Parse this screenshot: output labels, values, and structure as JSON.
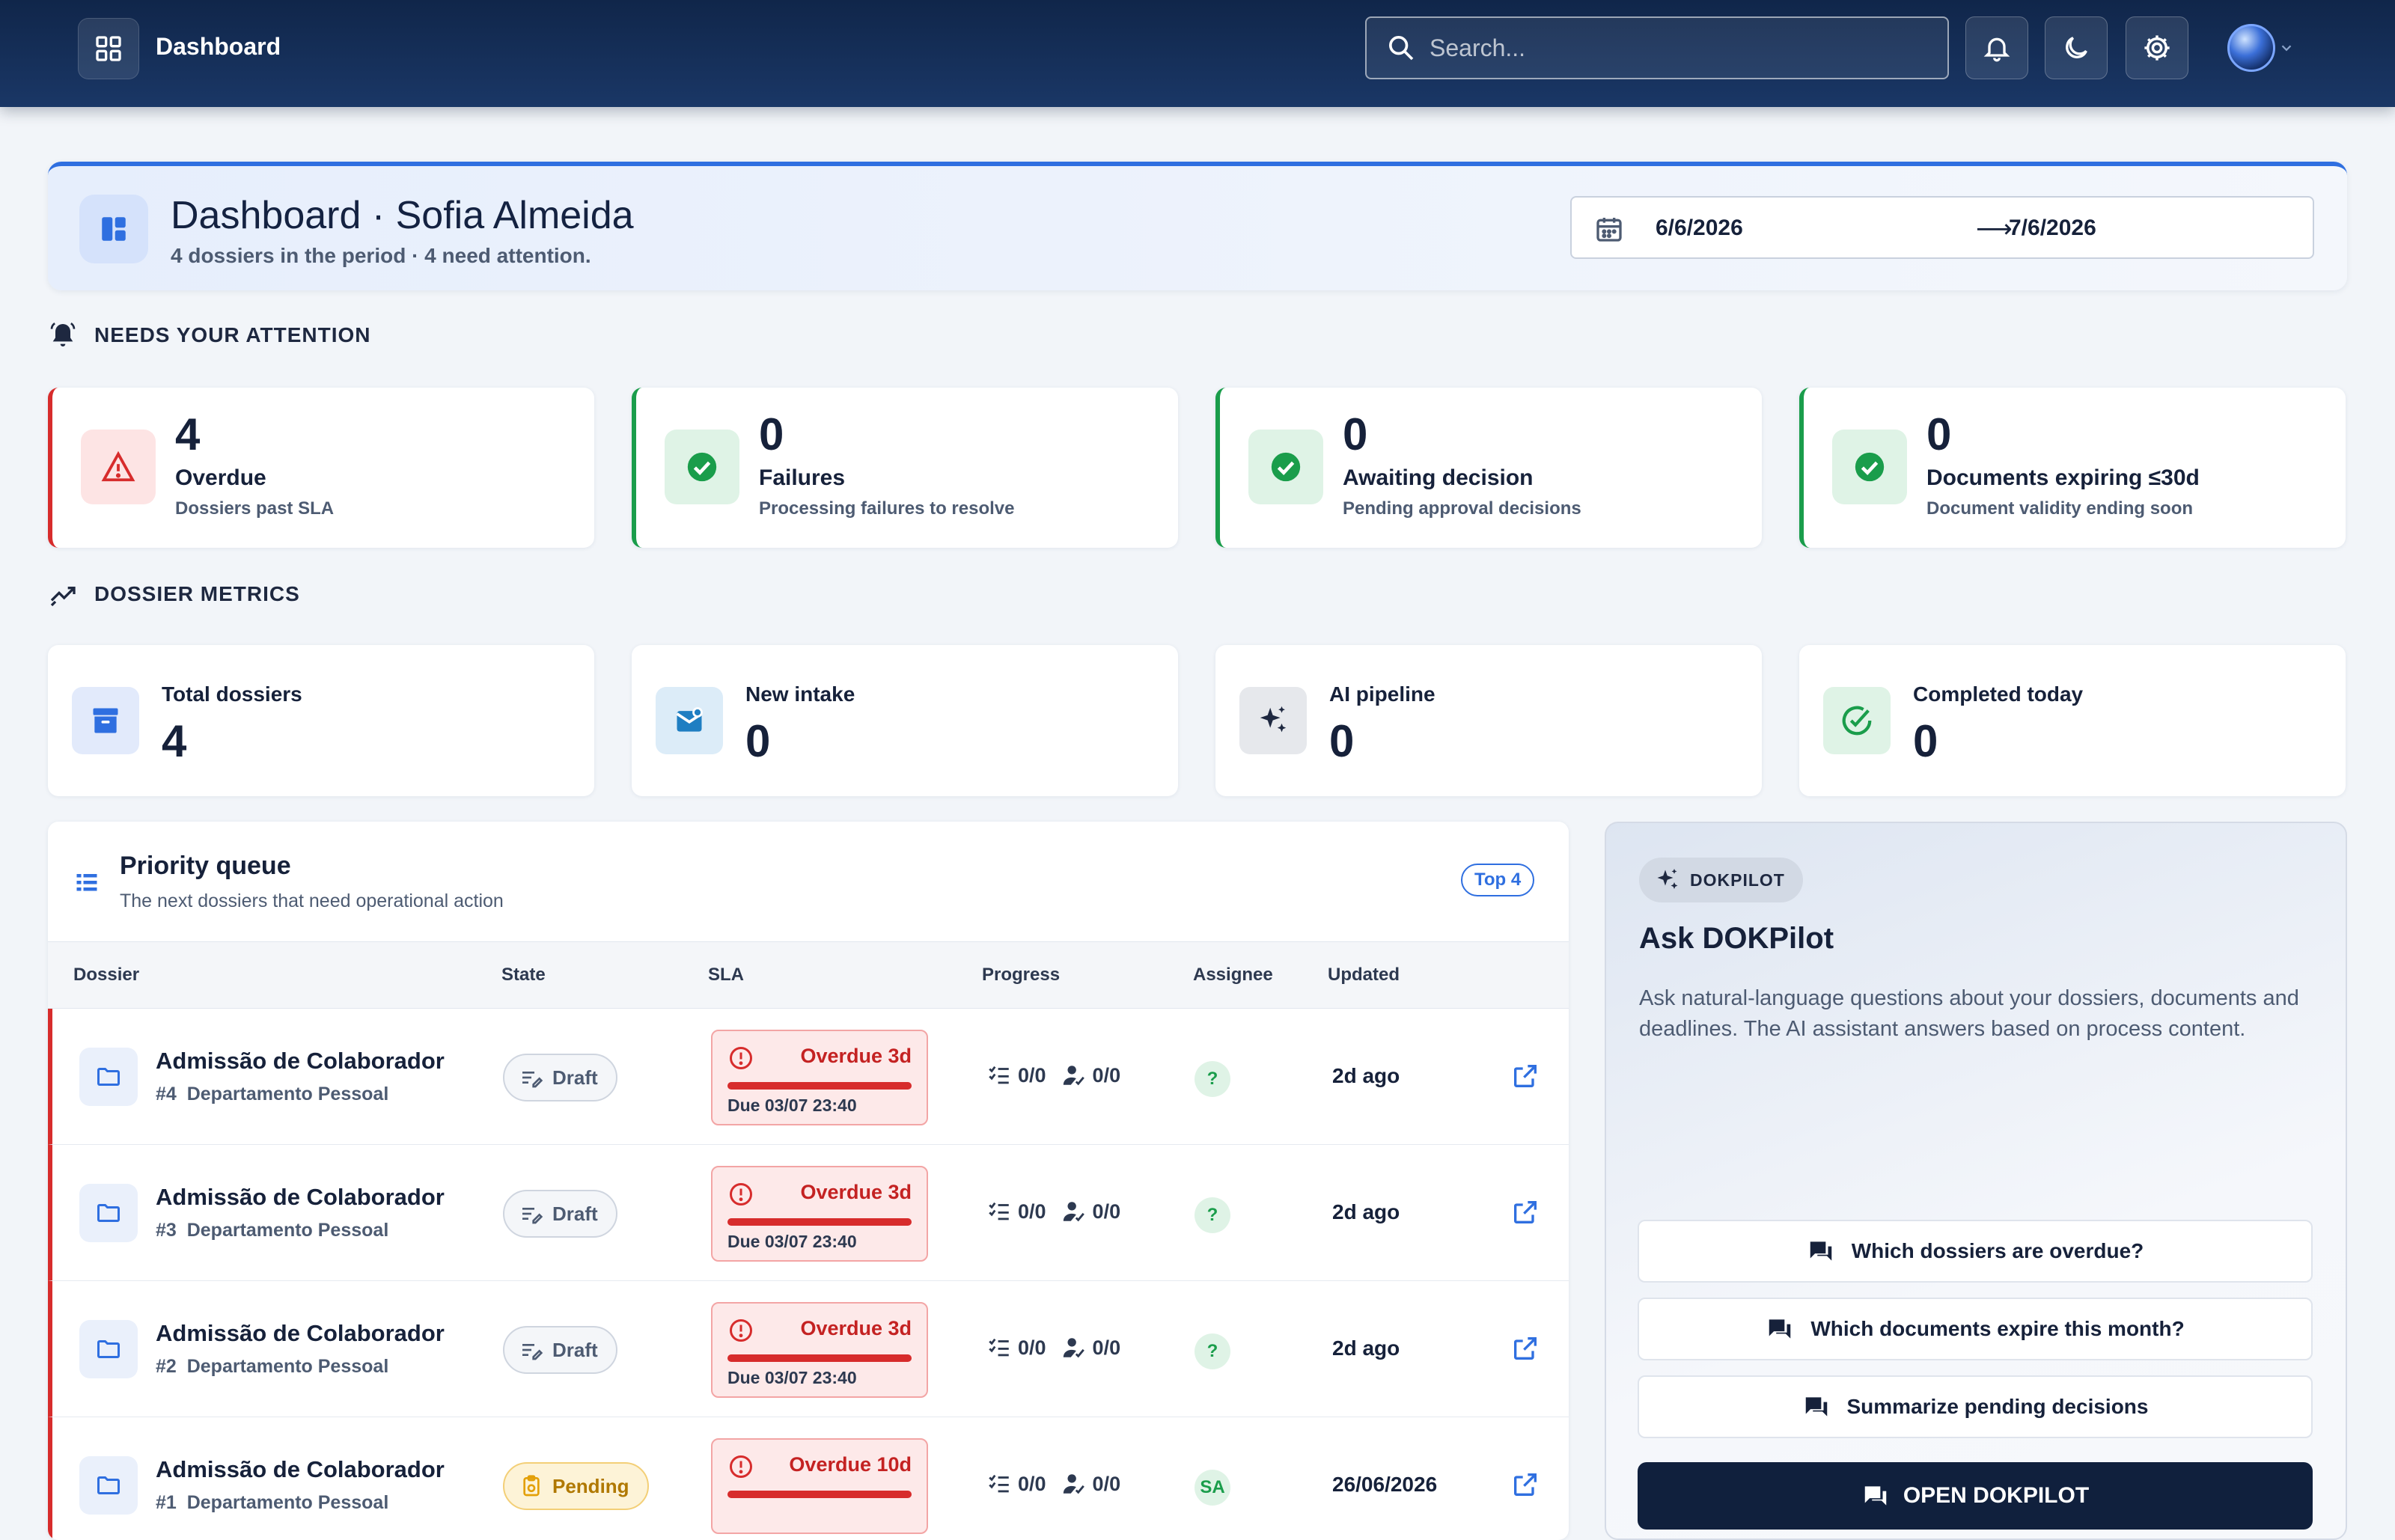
{
  "topbar": {
    "title": "Dashboard",
    "search_placeholder": "Search...",
    "icons": [
      "grid-icon",
      "search-icon",
      "bell-icon",
      "moon-icon",
      "gear-icon",
      "avatar",
      "chevron-down-icon"
    ]
  },
  "header": {
    "title": "Dashboard · Sofia Almeida",
    "subtitle": "4 dossiers in the period · 4 need attention.",
    "date_from": "6/6/2026",
    "date_arrow": "⟶",
    "date_to": "7/6/2026"
  },
  "attention": {
    "heading": "NEEDS YOUR ATTENTION",
    "cards": [
      {
        "value": "4",
        "label": "Overdue",
        "desc": "Dossiers past SLA",
        "status": "red"
      },
      {
        "value": "0",
        "label": "Failures",
        "desc": "Processing failures to resolve",
        "status": "green"
      },
      {
        "value": "0",
        "label": "Awaiting decision",
        "desc": "Pending approval decisions",
        "status": "green"
      },
      {
        "value": "0",
        "label": "Documents expiring ≤30d",
        "desc": "Document validity ending soon",
        "status": "green"
      }
    ]
  },
  "metrics": {
    "heading": "DOSSIER METRICS",
    "cards": [
      {
        "label": "Total dossiers",
        "value": "4"
      },
      {
        "label": "New intake",
        "value": "0"
      },
      {
        "label": "AI pipeline",
        "value": "0"
      },
      {
        "label": "Completed today",
        "value": "0"
      }
    ]
  },
  "queue": {
    "title": "Priority queue",
    "subtitle": "The next dossiers that need operational action",
    "badge": "Top 4",
    "columns": [
      "Dossier",
      "State",
      "SLA",
      "Progress",
      "Assignee",
      "Updated"
    ],
    "rows": [
      {
        "name": "Admissão de Colaborador",
        "id": "#4",
        "dept": "Departamento Pessoal",
        "state": "Draft",
        "sla": "Overdue 3d",
        "due": "Due 03/07 23:40",
        "sla_fill": 1.0,
        "tasks": "0/0",
        "people": "0/0",
        "assignee": "?",
        "updated": "2d ago"
      },
      {
        "name": "Admissão de Colaborador",
        "id": "#3",
        "dept": "Departamento Pessoal",
        "state": "Draft",
        "sla": "Overdue 3d",
        "due": "Due 03/07 23:40",
        "sla_fill": 1.0,
        "tasks": "0/0",
        "people": "0/0",
        "assignee": "?",
        "updated": "2d ago"
      },
      {
        "name": "Admissão de Colaborador",
        "id": "#2",
        "dept": "Departamento Pessoal",
        "state": "Draft",
        "sla": "Overdue 3d",
        "due": "Due 03/07 23:40",
        "sla_fill": 1.0,
        "tasks": "0/0",
        "people": "0/0",
        "assignee": "?",
        "updated": "2d ago"
      },
      {
        "name": "Admissão de Colaborador",
        "id": "#1",
        "dept": "Departamento Pessoal",
        "state": "Pending",
        "sla": "Overdue 10d",
        "due": "",
        "sla_fill": 1.0,
        "tasks": "0/0",
        "people": "0/0",
        "assignee": "SA",
        "updated": "26/06/2026"
      }
    ]
  },
  "pilot": {
    "chip": "DOKPILOT",
    "title": "Ask DOKPilot",
    "description": "Ask natural-language questions about your dossiers, documents and deadlines. The AI assistant answers based on process content.",
    "questions": [
      "Which dossiers are overdue?",
      "Which documents expire this month?",
      "Summarize pending decisions"
    ],
    "open_label": "OPEN DOKPILOT"
  },
  "colors": {
    "accent": "#2f6fe0",
    "danger": "#d72c2c",
    "success": "#1a9d4b",
    "warning": "#b07800",
    "navbar": "#10264a"
  }
}
